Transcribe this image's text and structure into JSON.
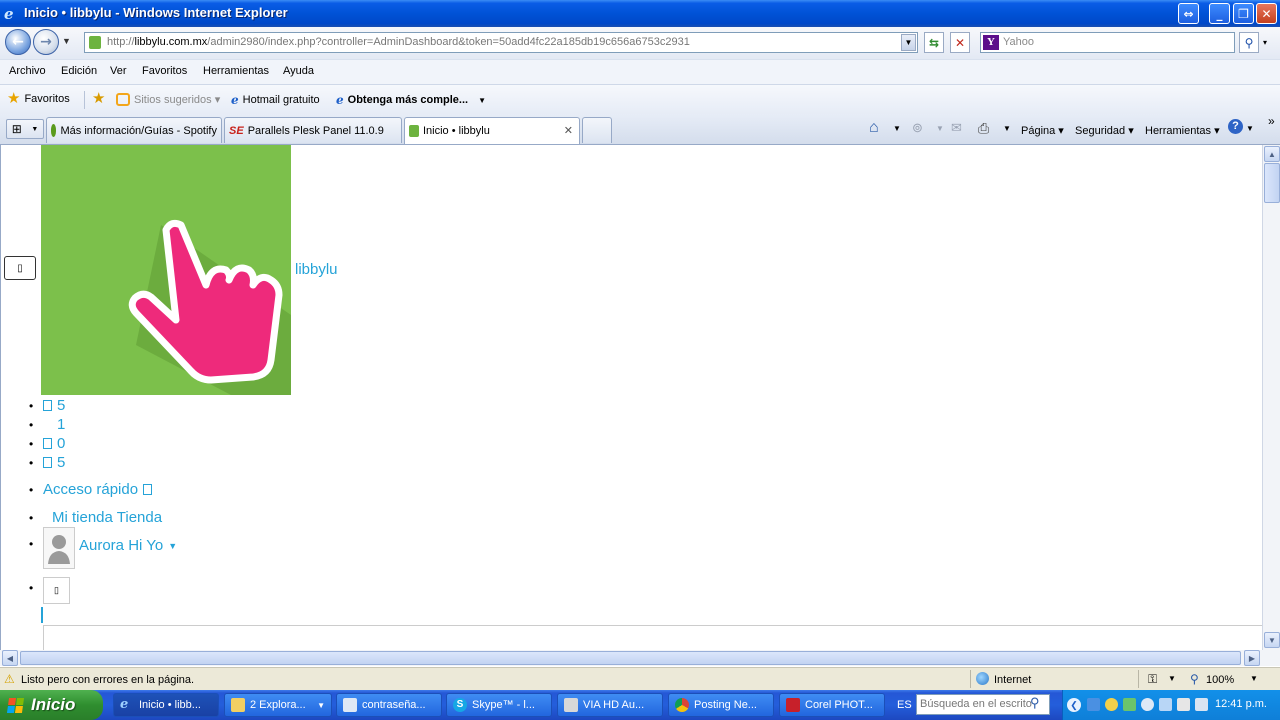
{
  "window": {
    "title": "Inicio • libbylu - Windows Internet Explorer",
    "buttons": {
      "restore_alt": "⇔",
      "minimize": "_",
      "maximize": "❐",
      "close": "✕"
    }
  },
  "address_bar": {
    "url_prefix": "http://",
    "url_domain": "libbylu.com.mx",
    "url_path": "/admin2980/index.php?controller=AdminDashboard&token=50add4fc22a185db19c656a6753c2931",
    "search_placeholder": "Yahoo",
    "search_provider_letter": "Y"
  },
  "menu": [
    "Archivo",
    "Edición",
    "Ver",
    "Favoritos",
    "Herramientas",
    "Ayuda"
  ],
  "favorites_bar": {
    "favorites_label": "Favoritos",
    "items": [
      "Sitios sugeridos ▾",
      "Hotmail gratuito",
      "Obtenga más comple..."
    ]
  },
  "tabs": [
    {
      "label": "Más información/Guías - Spotify",
      "active": false
    },
    {
      "label": "Parallels Plesk Panel 11.0.9",
      "active": false
    },
    {
      "label": "Inicio • libbylu",
      "active": true
    }
  ],
  "command_bar": [
    "Página ▾",
    "Seguridad ▾",
    "Herramientas ▾"
  ],
  "page": {
    "site_name": "libbylu",
    "toggle_glyph": "▯",
    "notifications": [
      {
        "glyph": "▯",
        "count": "5"
      },
      {
        "glyph": "",
        "count": "1"
      },
      {
        "glyph": "▯",
        "count": "0"
      },
      {
        "glyph": "▯",
        "count": "5"
      }
    ],
    "quick_access": "Acceso rápido",
    "my_store": "Mi tienda Tienda",
    "user_name": "Aurora Hi Yo",
    "box_glyph": "▯"
  },
  "status_bar": {
    "message": "Listo pero con errores en la página.",
    "zone": "Internet",
    "zoom": "100%"
  },
  "taskbar": {
    "start_label": "Inicio",
    "buttons": [
      {
        "label": "Inicio • libb...",
        "active": true
      },
      {
        "label": "2 Explora...",
        "active": false
      },
      {
        "label": "contraseña...",
        "active": false
      },
      {
        "label": "Skype™ - l...",
        "active": false
      },
      {
        "label": "VIA HD Au...",
        "active": false
      },
      {
        "label": "Posting Ne...",
        "active": false
      },
      {
        "label": "Corel PHOT...",
        "active": false
      }
    ],
    "language": "ES",
    "search_placeholder": "Búsqueda en el escrito",
    "clock": "12:41 p.m."
  }
}
